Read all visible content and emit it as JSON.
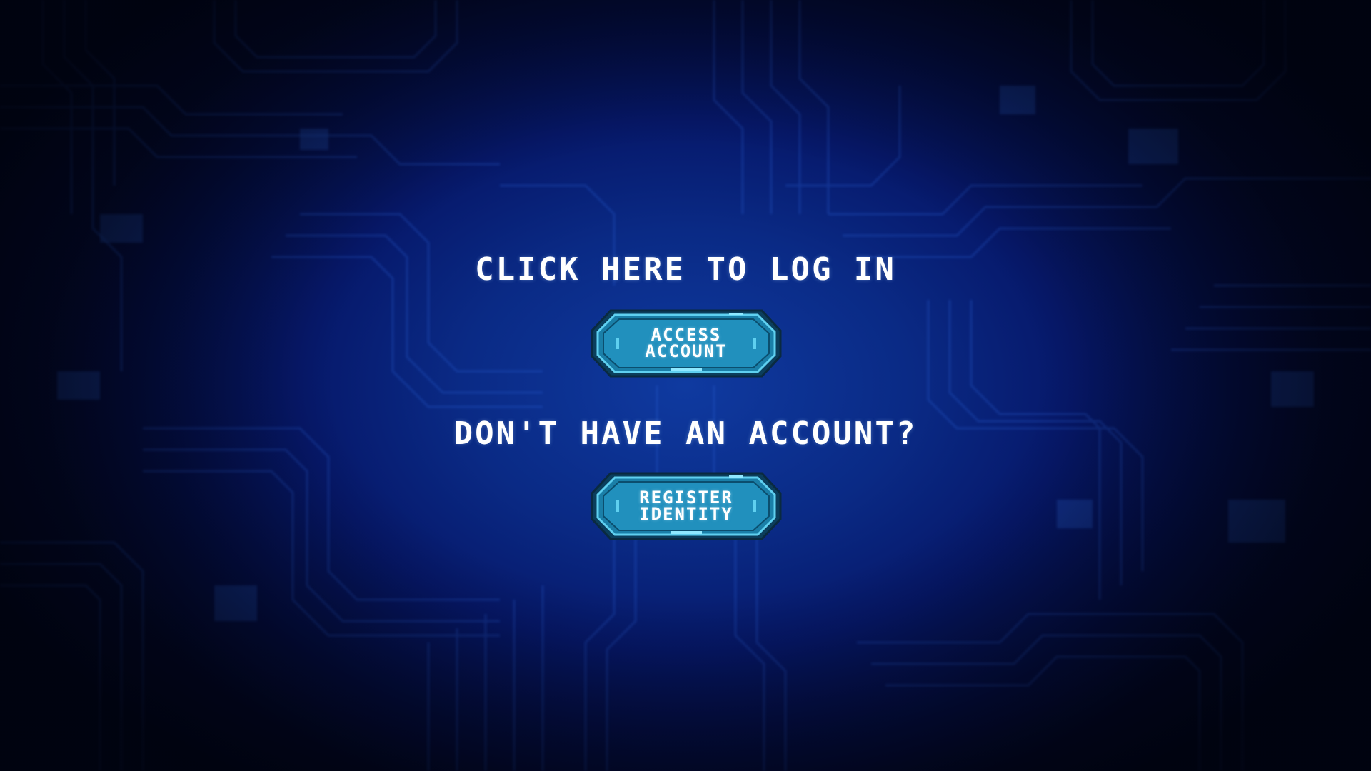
{
  "login": {
    "heading": "CLICK HERE TO LOG IN",
    "button_line1": "ACCESS",
    "button_line2": "ACCOUNT"
  },
  "register": {
    "heading": "DON'T HAVE AN ACCOUNT?",
    "button_line1": "REGISTER",
    "button_line2": "IDENTITY"
  },
  "colors": {
    "background": "#0a2a85",
    "button_fill": "#1a7fa8",
    "button_border": "#5fd0f0",
    "text": "#ffffff"
  },
  "icons": [
    "circuit-board-background"
  ]
}
